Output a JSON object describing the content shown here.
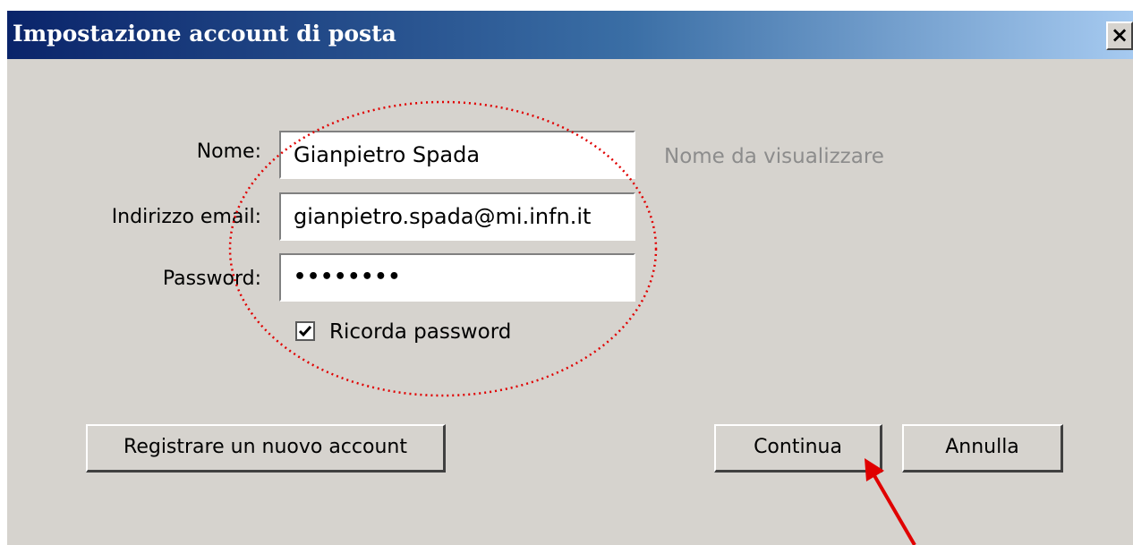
{
  "window": {
    "title": "Impostazione account di posta",
    "close_glyph": "×"
  },
  "form": {
    "name_label": "Nome:",
    "name_value": "Gianpietro Spada",
    "name_hint": "Nome da visualizzare",
    "email_label": "Indirizzo email:",
    "email_value": "gianpietro.spada@mi.infn.it",
    "password_label": "Password:",
    "password_value": "••••••••",
    "remember_label": "Ricorda password",
    "remember_checked": true
  },
  "buttons": {
    "register": "Registrare un nuovo account",
    "continue": "Continua",
    "cancel": "Annulla"
  },
  "annotation": {
    "ellipse_color": "#e00000",
    "arrow_color": "#e00000"
  }
}
